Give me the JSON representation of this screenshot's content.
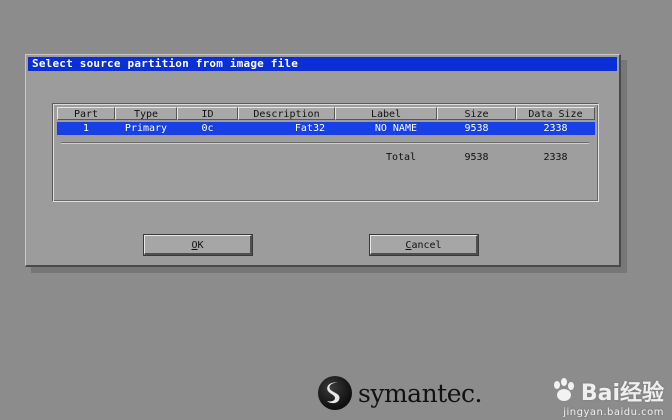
{
  "dialog": {
    "title": "Select source partition from image file",
    "columns": [
      "Part",
      "Type",
      "ID",
      "Description",
      "Label",
      "Size",
      "Data Size"
    ],
    "rows": [
      {
        "part": "1",
        "type": "Primary",
        "id": "0c",
        "description": "Fat32",
        "label": "NO NAME",
        "size": "9538",
        "data_size": "2338"
      }
    ],
    "totals": {
      "label": "Total",
      "size": "9538",
      "data_size": "2338"
    },
    "ok_prefix": "",
    "ok_hotkey": "O",
    "ok_rest": "K",
    "cancel_hotkey": "C",
    "cancel_rest": "ancel",
    "selection_color": "#1740e6",
    "title_color": "#0b2fd6"
  },
  "branding": {
    "logo_text": "symantec.",
    "watermark_main": "Bai经验",
    "watermark_sub": "jingyan.baidu.com"
  }
}
